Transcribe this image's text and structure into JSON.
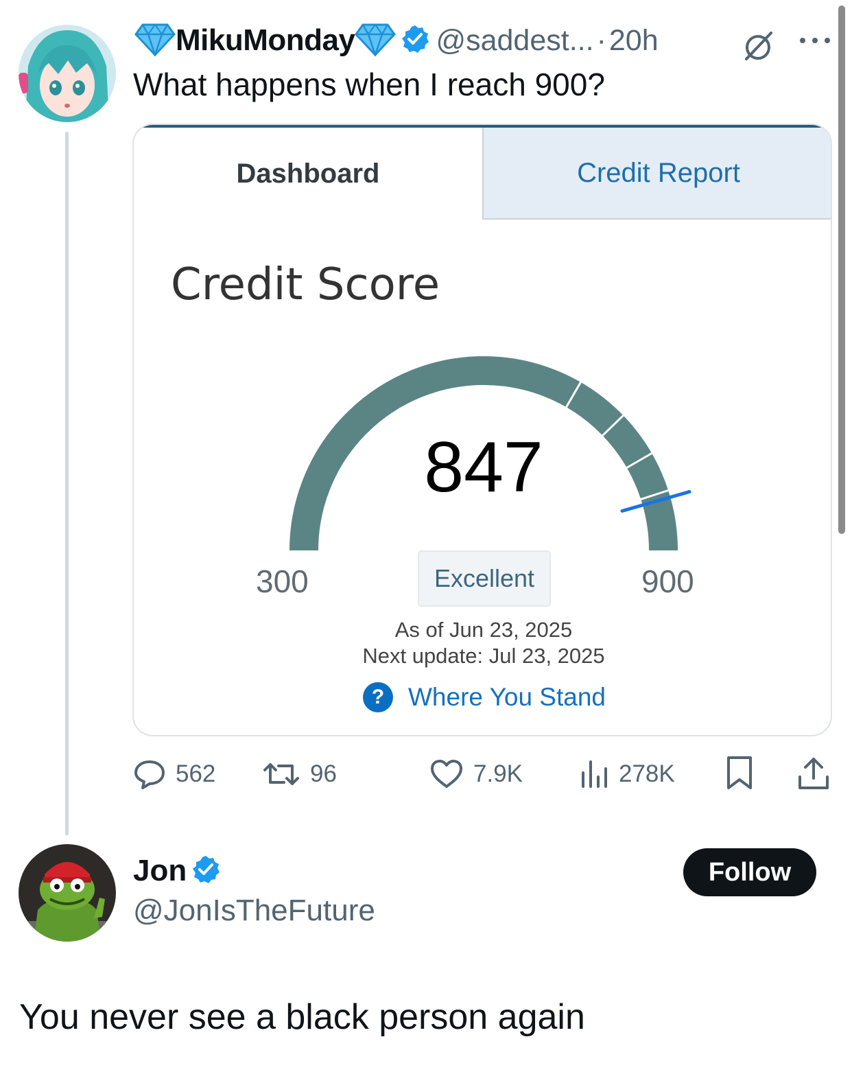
{
  "tweet": {
    "display_name": "MikuMonday",
    "handle": "@saddest...",
    "separator": "·",
    "time": "20h",
    "text": "What happens when I reach 900?",
    "icons": [
      "gem-icon",
      "verified-badge-icon",
      "grok-icon",
      "more-icon",
      "avatar"
    ]
  },
  "card": {
    "tabs": [
      {
        "label": "Dashboard",
        "active": true
      },
      {
        "label": "Credit Report",
        "active": false
      }
    ],
    "title": "Credit Score",
    "gauge": {
      "score": "847",
      "score_value": 847,
      "min": "300",
      "max": "900",
      "min_value": 300,
      "max_value": 900,
      "rating": "Excellent",
      "arc_color": "#5b8584",
      "marker_color": "#1a73e8"
    },
    "as_of": "As of Jun 23, 2025",
    "next_update": "Next update: Jul 23, 2025",
    "help_icon": "?",
    "help_link": "Where You Stand"
  },
  "actions": {
    "replies": "562",
    "retweets": "96",
    "likes": "7.9K",
    "views": "278K",
    "icons": [
      "reply-icon",
      "retweet-icon",
      "like-icon",
      "views-icon",
      "bookmark-icon",
      "share-icon"
    ]
  },
  "reply": {
    "display_name": "Jon",
    "handle": "@JonIsTheFuture",
    "follow_label": "Follow",
    "text": "You never see a black person again"
  },
  "colors": {
    "text_primary": "#0f1419",
    "text_secondary": "#536471",
    "verified": "#1d9bf0",
    "link": "#1570c0"
  }
}
